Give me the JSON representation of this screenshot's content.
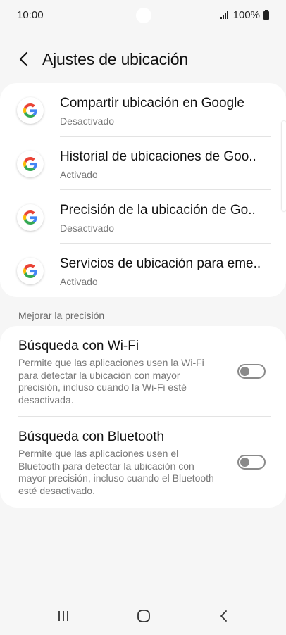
{
  "status_bar": {
    "time": "10:00",
    "battery": "100%"
  },
  "header": {
    "back_icon": "chevron-left-icon",
    "title": "Ajustes de ubicación"
  },
  "google_items": [
    {
      "icon": "google-g-icon",
      "title": "Compartir ubicación en Google",
      "status": "Desactivado"
    },
    {
      "icon": "google-g-icon",
      "title": "Historial de ubicaciones de Goo..",
      "status": "Activado"
    },
    {
      "icon": "google-g-icon",
      "title": "Precisión de la ubicación de Go..",
      "status": "Desactivado"
    },
    {
      "icon": "google-g-icon",
      "title": "Servicios de ubicación para eme..",
      "status": "Activado"
    }
  ],
  "accuracy_section": {
    "label": "Mejorar la precisión",
    "wifi": {
      "title": "Búsqueda con Wi-Fi",
      "description": "Permite que las aplicaciones usen la Wi-Fi para detectar la ubicación con mayor precisión, incluso cuando la Wi-Fi esté desactivada.",
      "enabled": false
    },
    "bluetooth": {
      "title": "Búsqueda con Bluetooth",
      "description": "Permite que las aplicaciones usen el Bluetooth para detectar la ubicación con mayor precisión, incluso cuando el Bluetooth esté desactivado.",
      "enabled": false
    }
  },
  "nav_bar": {
    "recents_icon": "recents-icon",
    "home_icon": "home-icon",
    "back_icon": "back-icon"
  },
  "colors": {
    "background": "#f6f6f6",
    "card": "#ffffff",
    "toggle_off": "#8a8a8a",
    "google_blue": "#4285F4",
    "google_red": "#EA4335",
    "google_yellow": "#FBBC05",
    "google_green": "#34A853"
  }
}
